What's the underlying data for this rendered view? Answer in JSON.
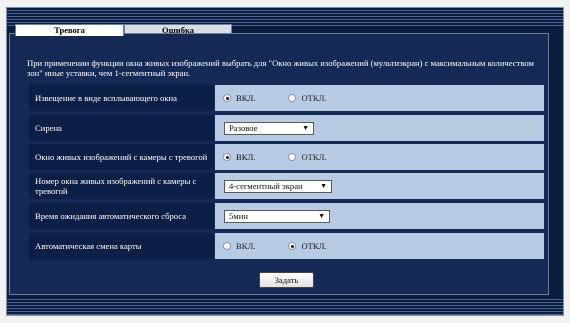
{
  "tabs": [
    {
      "label": "Тревога",
      "active": true
    },
    {
      "label": "Ошибка",
      "active": false
    }
  ],
  "notice": "При применении функции окна живых изображений выбрать для \"Окно живых изображений (мультиэкран) с максимальным количеством зон\" иные уставки, чем 1-сегментный экран.",
  "rows": {
    "popup": {
      "label": "Извещение в виде всплывающего окна",
      "option_on": "ВКЛ.",
      "option_off": "ОТКЛ.",
      "selected": "on"
    },
    "siren": {
      "label": "Сирена",
      "value": "Разовое"
    },
    "alarm_camera": {
      "label": "Окно живых изображений с камеры с тревогой",
      "option_on": "ВКЛ.",
      "option_off": "ОТКЛ.",
      "selected": "on"
    },
    "window_number": {
      "label": "Номер окна живых изображений с камеры с тревогой",
      "value": "4-сегментный экран"
    },
    "auto_reset": {
      "label": "Время ожидания автоматического сброса",
      "value": "5мин"
    },
    "map_switch": {
      "label": "Автоматическая смена карты",
      "option_on": "ВКЛ.",
      "option_off": "ОТКЛ.",
      "selected": "off"
    }
  },
  "buttons": {
    "set_label": "Задать"
  },
  "icons": {
    "dropdown": "chevron-down-icon"
  },
  "colors": {
    "background_dark": "#0b1d3f",
    "label_bg": "#0c1f47",
    "value_bg": "#b8cbe5"
  }
}
